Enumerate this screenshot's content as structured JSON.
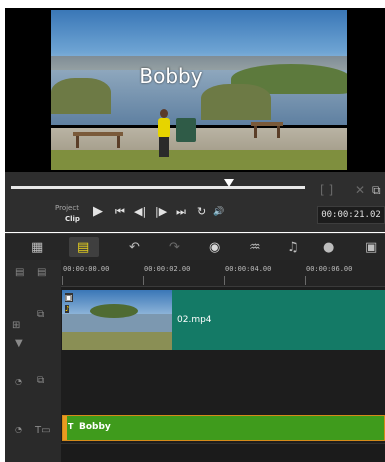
{
  "preview": {
    "title_overlay": "Bobby"
  },
  "controls": {
    "mode_project": "Project",
    "mode_clip": "Clip",
    "timecode": "00:00:21.02",
    "scrub_position_fraction": 0.74,
    "buttons": {
      "play": "▶",
      "home": "⏮",
      "prev_frame": "◀|",
      "next_frame": "|▶",
      "end": "⏭",
      "repeat": "↻",
      "volume": "🔊"
    },
    "top_right_icons": [
      "[ ]",
      "✕",
      "⧉"
    ]
  },
  "toolbar": {
    "icons": [
      "storyboard-view-icon",
      "timeline-view-icon",
      "undo-icon",
      "redo-icon",
      "record-capture-icon",
      "sound-mixer-icon",
      "auto-music-icon",
      "motion-tracking-icon",
      "subtitle-icon"
    ]
  },
  "ruler": {
    "ticks": [
      "00:00:00.00",
      "00:00:02.00",
      "00:00:04.00",
      "00:00:06.00"
    ]
  },
  "tracks": {
    "video_clip_label": "02.mp4",
    "title_clip_label": "Bobby",
    "title_clip_type": "T"
  }
}
